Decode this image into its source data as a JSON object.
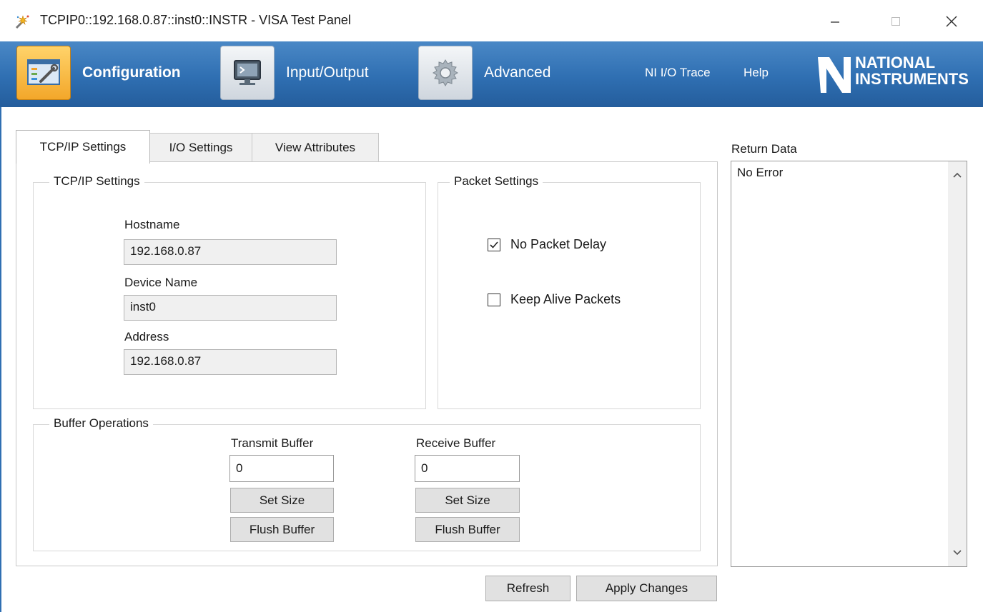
{
  "window": {
    "title": "TCPIP0::192.168.0.87::inst0::INSTR - VISA Test Panel"
  },
  "toolbar": {
    "configuration_label": "Configuration",
    "input_output_label": "Input/Output",
    "advanced_label": "Advanced",
    "io_trace_label": "NI I/O Trace",
    "help_label": "Help",
    "logo_line1": "NATIONAL",
    "logo_line2": "INSTRUMENTS",
    "active": "Configuration"
  },
  "tabs": [
    {
      "label": "TCP/IP Settings",
      "active": true
    },
    {
      "label": "I/O Settings",
      "active": false
    },
    {
      "label": "View Attributes",
      "active": false
    }
  ],
  "tcpip": {
    "group_title": "TCP/IP Settings",
    "hostname_label": "Hostname",
    "hostname_value": "192.168.0.87",
    "device_name_label": "Device Name",
    "device_name_value": "inst0",
    "address_label": "Address",
    "address_value": "192.168.0.87"
  },
  "packet": {
    "group_title": "Packet Settings",
    "no_packet_delay_label": "No Packet Delay",
    "no_packet_delay_checked": true,
    "keep_alive_label": "Keep Alive Packets",
    "keep_alive_checked": false
  },
  "buffer": {
    "group_title": "Buffer Operations",
    "transmit_label": "Transmit Buffer",
    "transmit_value": "0",
    "receive_label": "Receive Buffer",
    "receive_value": "0",
    "set_size_label": "Set Size",
    "flush_label": "Flush Buffer"
  },
  "return_data": {
    "label": "Return Data",
    "text": "No Error"
  },
  "footer": {
    "refresh_label": "Refresh",
    "apply_label": "Apply Changes"
  }
}
